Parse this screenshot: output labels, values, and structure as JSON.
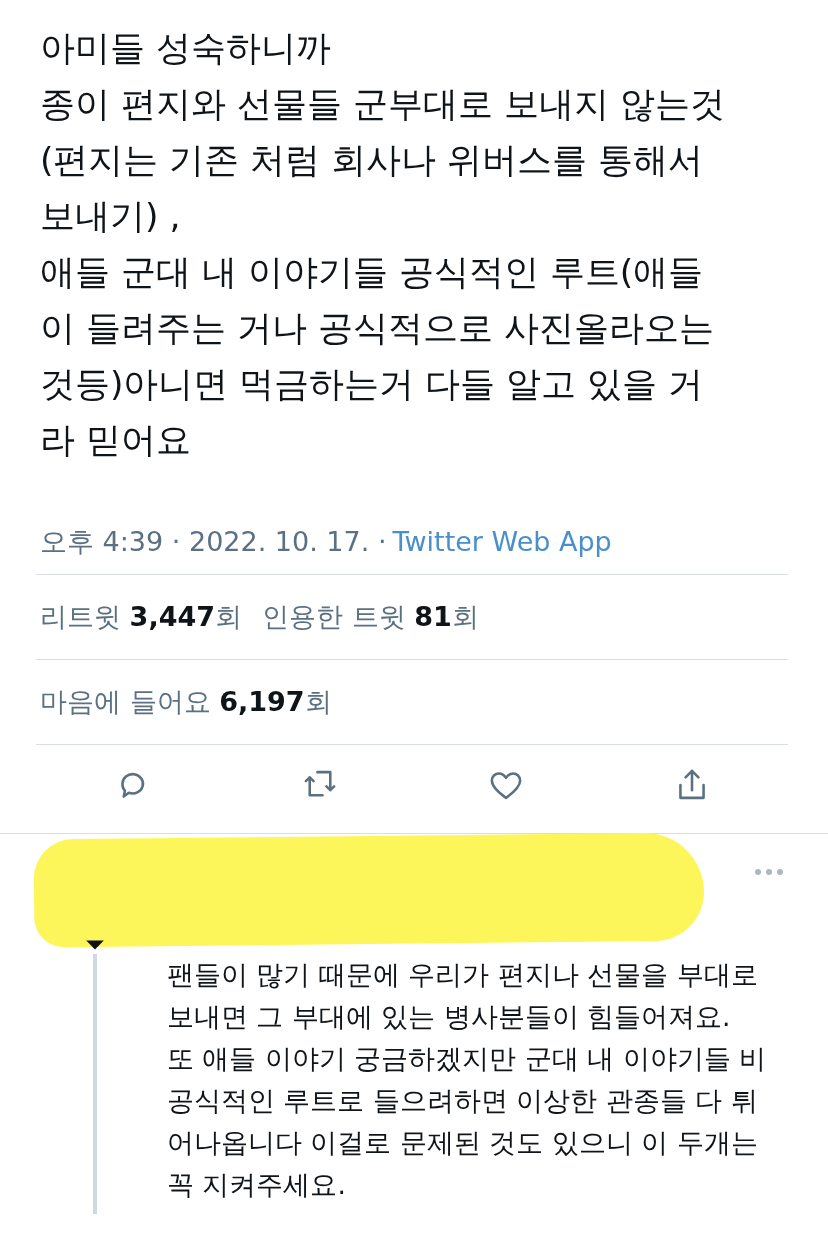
{
  "tweet": {
    "lines": [
      "아미들 성숙하니까",
      "종이 편지와 선물들 군부대로 보내지 않는것",
      "(편지는 기존 처럼 회사나 위버스를 통해서",
      "보내기) ,",
      "애들 군대 내 이야기들 공식적인 루트(애들",
      "이 들려주는 거나 공식적으로 사진올라오는",
      "것등)아니면 먹금하는거 다들 알고 있을 거",
      "라 믿어요"
    ],
    "time": "오후 4:39 · 2022. 10. 17. ·",
    "source": "Twitter Web App",
    "stats": [
      {
        "text": "리트윗 **3,447**회"
      },
      {
        "text": "인용한 트윗 **81**회"
      }
    ],
    "likes": "마음에 들어요 **6,197**회",
    "actions": [
      {
        "kind": "reply"
      },
      {
        "kind": "retweet"
      },
      {
        "kind": "like"
      },
      {
        "kind": "share"
      }
    ]
  },
  "reply": {
    "lines": [
      "팬들이 많기 때문에 우리가 편지나 선물을 부대로",
      "보내면  그 부대에 있는  병사분들이 힘들어져요.",
      "또 애들 이야기 궁금하겠지만 군대 내 이야기들 비",
      "공식적인 루트로 들으려하면 이상한 관종들 다 튀",
      "어나옵니다 이걸로 문제된 것도 있으니 이 두개는",
      "꼭 지켜주세요."
    ]
  }
}
